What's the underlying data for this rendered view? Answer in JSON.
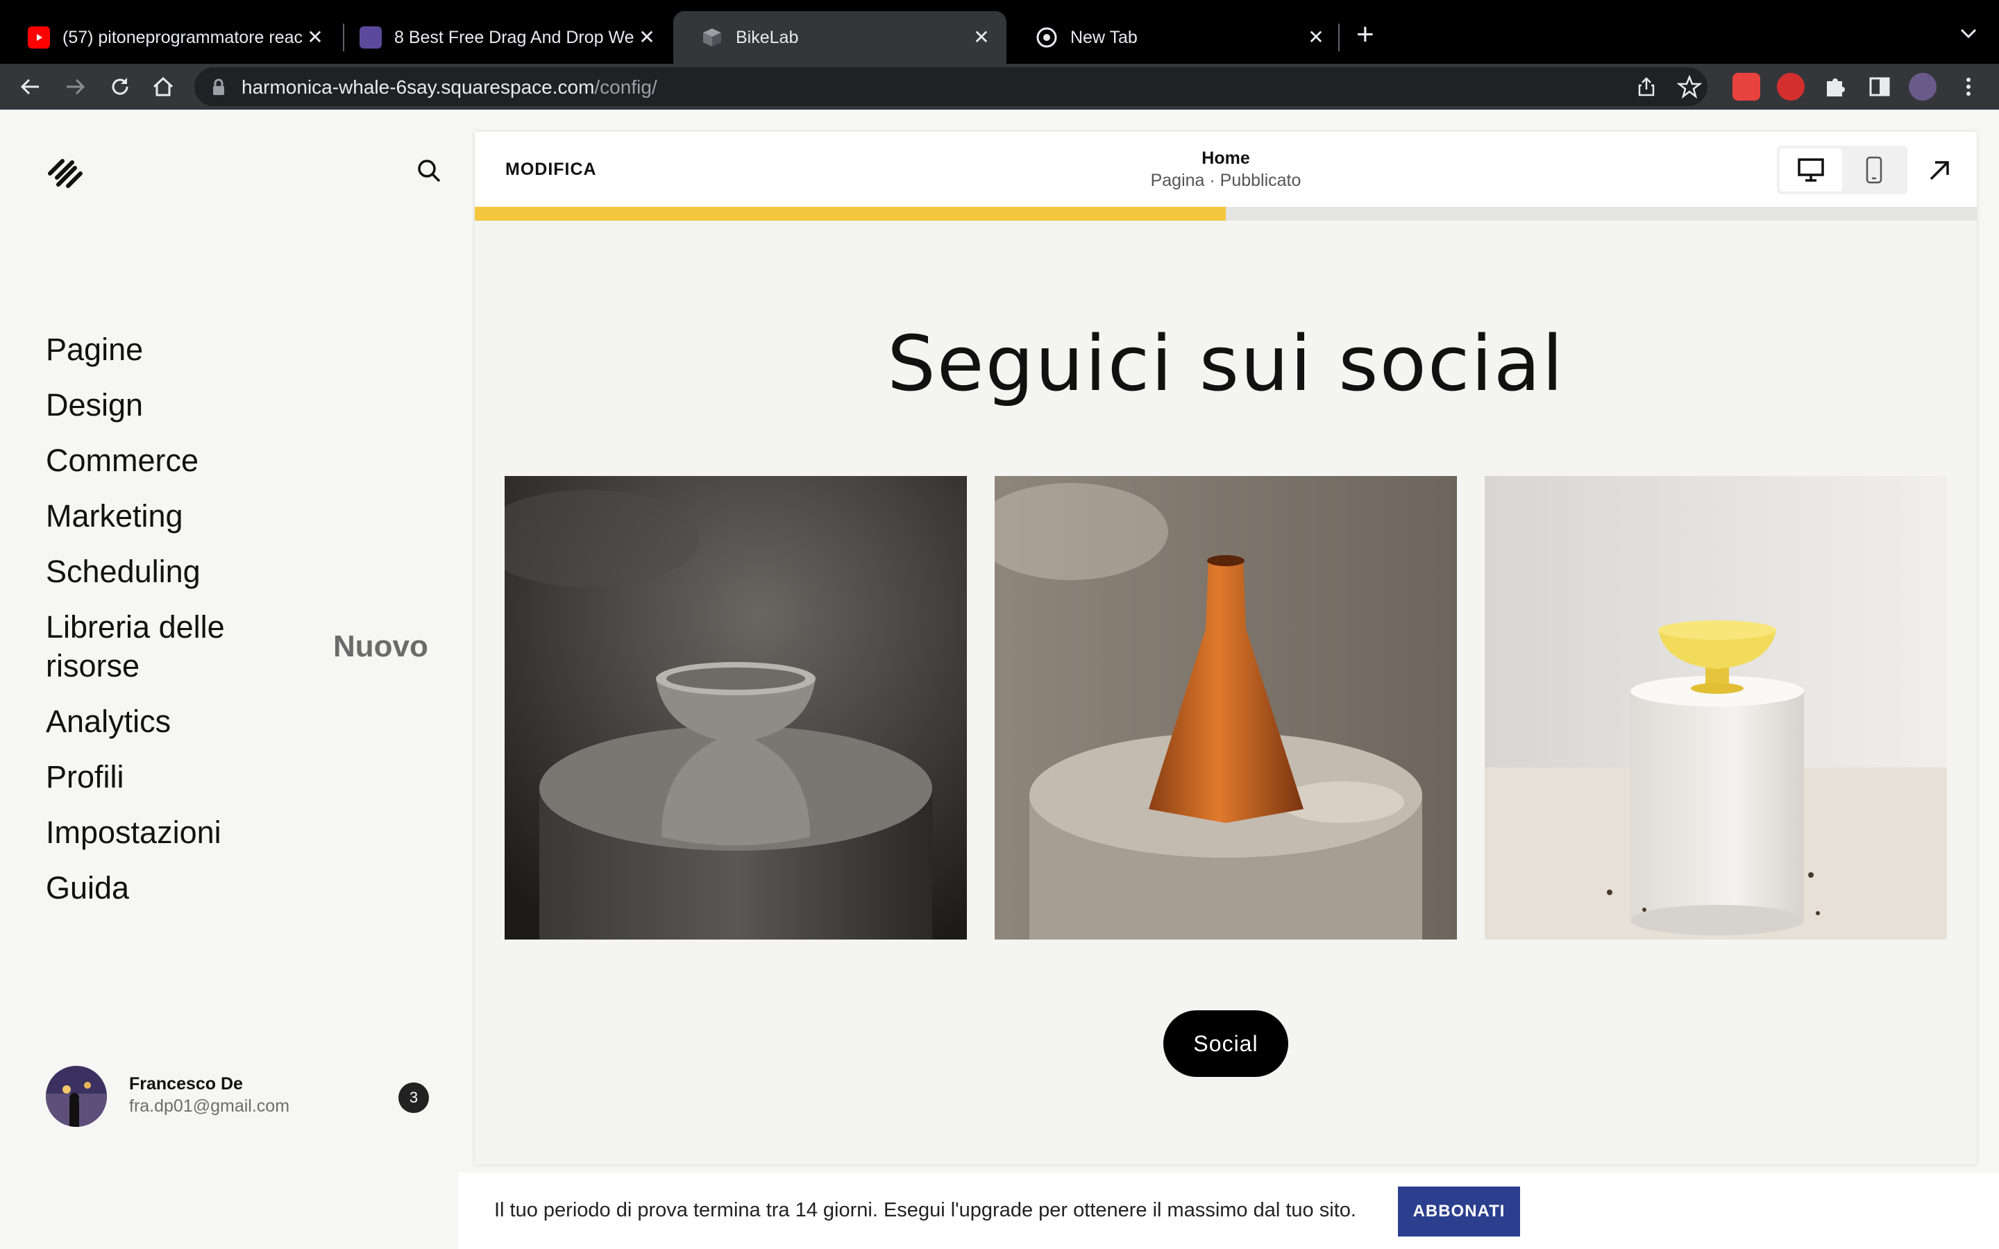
{
  "browser": {
    "tabs": [
      {
        "title": "(57) pitoneprogrammatore reac",
        "icon": "youtube-icon",
        "active": false
      },
      {
        "title": "8 Best Free Drag And Drop We",
        "icon": "colorlib-icon",
        "active": false
      },
      {
        "title": "BikeLab",
        "icon": "squarespace-cube-icon",
        "active": true
      },
      {
        "title": "New Tab",
        "icon": "chrome-icon",
        "active": false
      }
    ],
    "close_glyph": "✕",
    "new_tab_glyph": "+",
    "url_host": "harmonica-whale-6say.squarespace.com",
    "url_path": "/config/"
  },
  "sidebar": {
    "nav": [
      {
        "label": "Pagine"
      },
      {
        "label": "Design"
      },
      {
        "label": "Commerce"
      },
      {
        "label": "Marketing"
      },
      {
        "label": "Scheduling"
      },
      {
        "label": "Libreria delle risorse",
        "badge": "Nuovo"
      },
      {
        "label": "Analytics"
      },
      {
        "label": "Profili"
      },
      {
        "label": "Impostazioni"
      },
      {
        "label": "Guida"
      }
    ],
    "user": {
      "name": "Francesco De",
      "email": "fra.dp01@gmail.com",
      "notifications": "3"
    }
  },
  "editor": {
    "edit_label": "MODIFICA",
    "page_title": "Home",
    "page_subtitle": "Pagina · Pubblicato",
    "progress": 0.5
  },
  "content": {
    "headline": "Seguici sui social",
    "button_label": "Social"
  },
  "banner": {
    "text": "Il tuo periodo di prova termina tra 14 giorni. Esegui l'upgrade per ottenere il massimo dal tuo sito.",
    "button_label": "ABBONATI"
  },
  "colors": {
    "accent_progress": "#f4c73f",
    "banner_button": "#2b3f8e"
  }
}
